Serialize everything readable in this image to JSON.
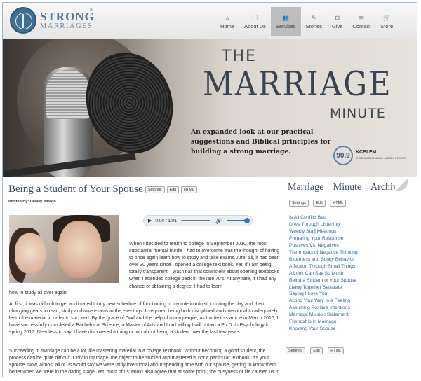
{
  "logo": {
    "line1": "STRONG",
    "line2": "MARRIAGES",
    "reg": "®"
  },
  "nav": [
    {
      "label": "Home",
      "icon": "⌂",
      "active": false
    },
    {
      "label": "About Us",
      "icon": "ⓘ",
      "active": false
    },
    {
      "label": "Services",
      "icon": "👥",
      "active": true
    },
    {
      "label": "Stories",
      "icon": "✎",
      "active": false
    },
    {
      "label": "Give",
      "icon": "⊡",
      "active": false
    },
    {
      "label": "Contact",
      "icon": "✉",
      "active": false
    },
    {
      "label": "Store",
      "icon": "🛒",
      "active": false
    }
  ],
  "banner": {
    "the": "THE",
    "marriage": "MARRIAGE",
    "minute": "MINUTE",
    "description": "An expanded look at our practical suggestions and Biblical principles for building a strong marriage.",
    "station_number": "90.9",
    "station_name": "KCBI FM",
    "station_tagline": "ENCOURAGING MUSIC...WORDS OF HOPE"
  },
  "article": {
    "title": "Being a Student of Your Spouse",
    "buttons": [
      "Settings",
      "Edit",
      "HTML"
    ],
    "author": "Written By: Dewey Wilson",
    "audio": {
      "time": "0:00 / 1:01",
      "play_icon": "▶",
      "volume_icon": "🔊"
    },
    "p1": "When I decided to return to college in September 2010, the most substantial mental hurdle I had to overcome was the thought of having to once again learn how to study and take exams. After all, it had been over 30 years since I opened a college text book. Yet, if I am being totally transparent, I wasn't all that consistent about opening textbooks when I attended college back in the late 70's! At any rate, if I had any chance of obtaining a degree, I had to learn",
    "p1_cont": "how to study all over again.",
    "p2": "At first, it was difficult to get acclimated to my new schedule of functioning in my role in ministry during the day and then changing gears to read, study and take exams in the evenings. It required being both disciplined and intentional to adequately learn the material in order to succeed. By the grace of God and the help of many people, as I write this article in March 2016, I have successfully completed a Bachelor of Science, a Master of Arts and Lord willing I will obtain a Ph.D. in Psychology in spring 2017. Needless to say, I have discovered a thing or two about being a student over the last few years.",
    "p3": "Succeeding in marriage can be a lot like mastering material in a college textbook. Without becoming a good student, the process can be quite difficult. Only in marriage, the object to be studied and mastered is not a particular textbook. It's your spouse. Now, almost all of us would say we were fairly intentional about spending time with our spouse, getting to know them better when we were in the dating stage. Yet, most of us would also agree that at some point, the busyness of life caused us to become less intentional once we were married."
  },
  "sidebar": {
    "title": "Marriage Minute Archive",
    "buttons": [
      "Settings",
      "Edit",
      "HTML"
    ],
    "items": [
      "Is All Conflict Bad",
      "Drive Through Listening",
      "Weekly Staff Meetings",
      "Preparing Your Response",
      "Positives Vs. Negatives",
      "The Impact of Negative Thinking",
      "Bitterness and Stinky Behavior",
      "Affection Through Small Things",
      "A Look Can Say So Much",
      "Being a Student of Your Spouse",
      "Living Together Separate",
      "Saying I Love You",
      "Acting Your Way to a Feeling",
      "Assuming Positive Intentions",
      "Marriage Mission Statement",
      "Friendship in Marriage",
      "Knowing Your Spouse"
    ],
    "bottom_buttons": [
      "Settings",
      "Edit",
      "HTML"
    ]
  },
  "colors": {
    "link": "#2b6bb5",
    "title": "#3c4a5a",
    "logo": "#3f6f94",
    "active_nav": "#bdbdbd"
  }
}
